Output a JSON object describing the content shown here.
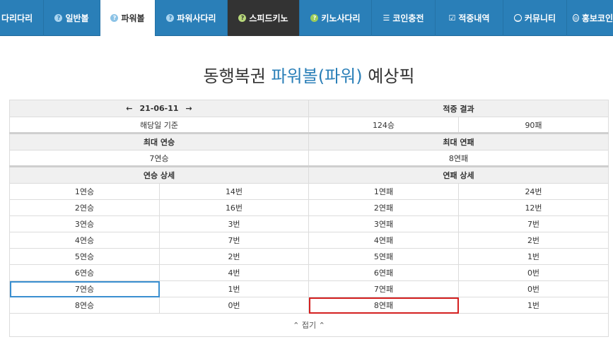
{
  "nav": {
    "items": [
      {
        "label": "다리다리",
        "icon": ""
      },
      {
        "label": "일반볼",
        "icon": "question"
      },
      {
        "label": "파워볼",
        "icon": "question"
      },
      {
        "label": "파워사다리",
        "icon": "question"
      },
      {
        "label": "스피드키노",
        "icon": "question"
      },
      {
        "label": "키노사다리",
        "icon": "question"
      },
      {
        "label": "코인충전",
        "icon": "database"
      },
      {
        "label": "적중내역",
        "icon": "check-square"
      },
      {
        "label": "커뮤니티",
        "icon": "smile"
      },
      {
        "label": "홍보코인",
        "icon": "coin"
      }
    ],
    "active_index": 2,
    "dark_index": 4
  },
  "title": {
    "prefix": "동행복권",
    "highlight": "파워볼(파워)",
    "suffix": "예상픽"
  },
  "summary": {
    "date": "21-06-11",
    "prev_arrow": "🡐",
    "next_arrow": "🡒",
    "hit_result_label": "적중 결과",
    "basis_label": "해당일 기준",
    "wins": "124승",
    "losses": "90패",
    "max_win_streak_label": "최대 연승",
    "max_lose_streak_label": "최대 연패",
    "max_win_streak": "7연승",
    "max_lose_streak": "8연패",
    "win_detail_label": "연승 상세",
    "lose_detail_label": "연패 상세"
  },
  "streak_rows": [
    {
      "win": "1연승",
      "win_count": "14번",
      "lose": "1연패",
      "lose_count": "24번"
    },
    {
      "win": "2연승",
      "win_count": "16번",
      "lose": "2연패",
      "lose_count": "12번"
    },
    {
      "win": "3연승",
      "win_count": "3번",
      "lose": "3연패",
      "lose_count": "7번"
    },
    {
      "win": "4연승",
      "win_count": "7번",
      "lose": "4연패",
      "lose_count": "2번"
    },
    {
      "win": "5연승",
      "win_count": "2번",
      "lose": "5연패",
      "lose_count": "1번"
    },
    {
      "win": "6연승",
      "win_count": "4번",
      "lose": "6연패",
      "lose_count": "0번"
    },
    {
      "win": "7연승",
      "win_count": "1번",
      "lose": "7연패",
      "lose_count": "0번"
    },
    {
      "win": "8연승",
      "win_count": "0번",
      "lose": "8연패",
      "lose_count": "1번"
    }
  ],
  "fold": {
    "label": "⌃ 접기 ⌃"
  },
  "colors": {
    "nav_bg": "#2a7fb8",
    "highlight": "#2a7fb8",
    "blue_box": "#3a8fd0",
    "red_box": "#d42020"
  }
}
